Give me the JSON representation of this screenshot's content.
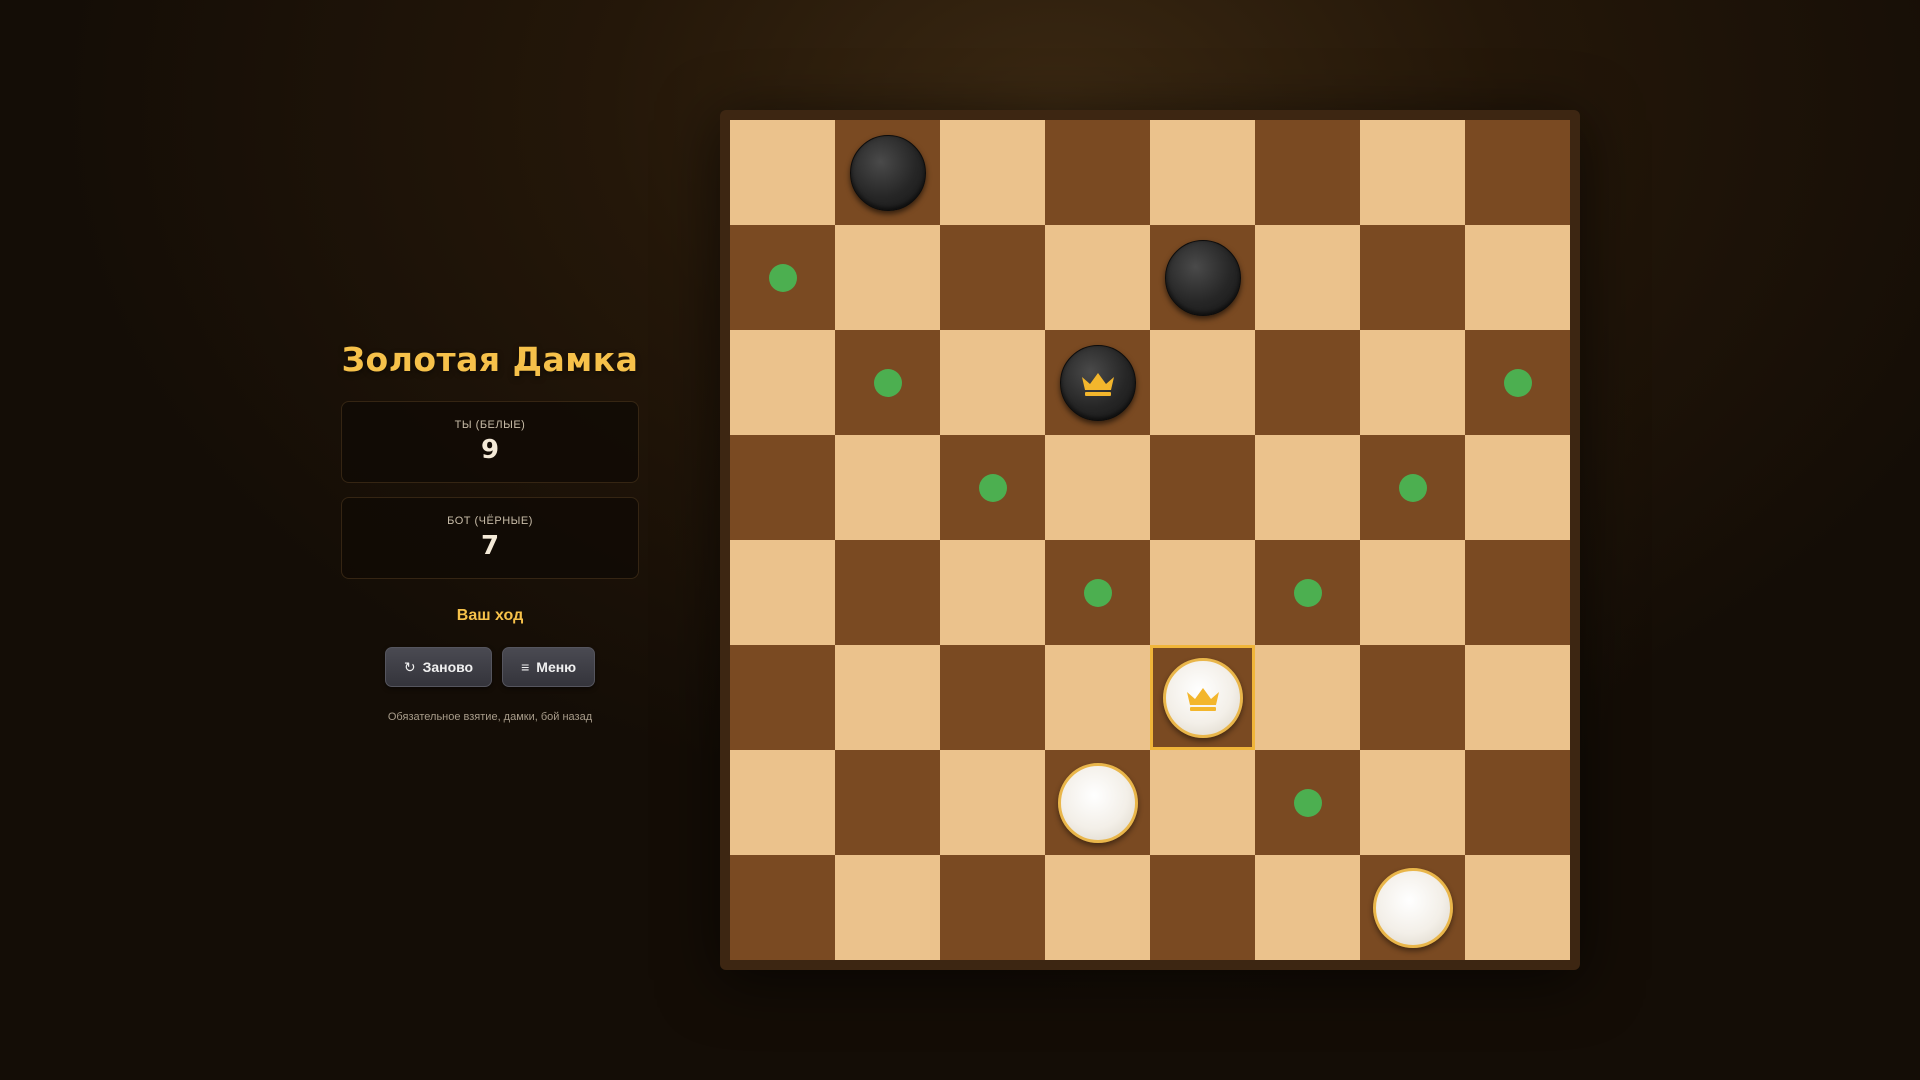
{
  "app": {
    "title": "Золотая Дамка"
  },
  "scores": {
    "player": {
      "label": "ТЫ (БЕЛЫЕ)",
      "value": "9"
    },
    "bot": {
      "label": "БОТ (ЧЁРНЫЕ)",
      "value": "7"
    }
  },
  "status": "Ваш ход",
  "buttons": {
    "restart": {
      "label": "Заново",
      "icon": "restart-icon"
    },
    "menu": {
      "label": "Меню",
      "icon": "menu-icon"
    }
  },
  "rules_note": "Обязательное взятие, дамки, бой назад",
  "colors": {
    "accent_gold": "#f6c14a",
    "light_square": "#ebc28c",
    "dark_square": "#7a4a22",
    "hint": "#4caf50",
    "selection": "#f0b53a"
  },
  "board": {
    "size": 8,
    "pieces": [
      {
        "row": 0,
        "col": 1,
        "color": "black",
        "king": false
      },
      {
        "row": 1,
        "col": 4,
        "color": "black",
        "king": false
      },
      {
        "row": 2,
        "col": 3,
        "color": "black",
        "king": true
      },
      {
        "row": 5,
        "col": 4,
        "color": "white",
        "king": true,
        "selected": true
      },
      {
        "row": 6,
        "col": 3,
        "color": "white",
        "king": false
      },
      {
        "row": 7,
        "col": 6,
        "color": "white",
        "king": false
      }
    ],
    "hints": [
      {
        "row": 1,
        "col": 0
      },
      {
        "row": 2,
        "col": 1
      },
      {
        "row": 2,
        "col": 7
      },
      {
        "row": 3,
        "col": 2
      },
      {
        "row": 3,
        "col": 6
      },
      {
        "row": 4,
        "col": 3
      },
      {
        "row": 4,
        "col": 5
      },
      {
        "row": 6,
        "col": 5
      }
    ]
  }
}
